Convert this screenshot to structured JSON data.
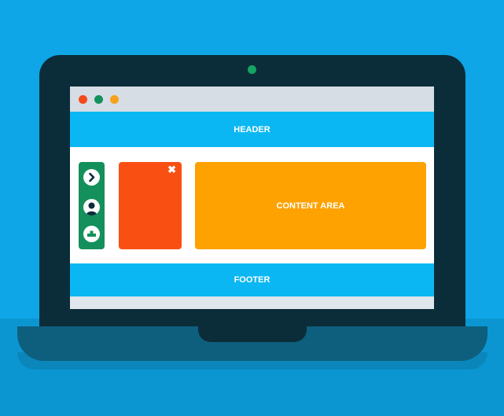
{
  "layout": {
    "header_label": "HEADER",
    "content_label": "CONTENT AREA",
    "footer_label": "FOOTER"
  },
  "window_controls": {
    "close_color": "#f44a1b",
    "minimize_color": "#14915c",
    "maximize_color": "#f7a11a"
  },
  "sidebar": {
    "icons": [
      "chevron-right-icon",
      "user-icon",
      "bar-chart-icon"
    ]
  },
  "panel": {
    "close_glyph": "✖"
  },
  "colors": {
    "background": "#0ea6e6",
    "laptop": "#0b2d39",
    "header_footer": "#0bb7f2",
    "sidebar": "#13905b",
    "panel": "#f94f12",
    "content": "#fda200"
  }
}
